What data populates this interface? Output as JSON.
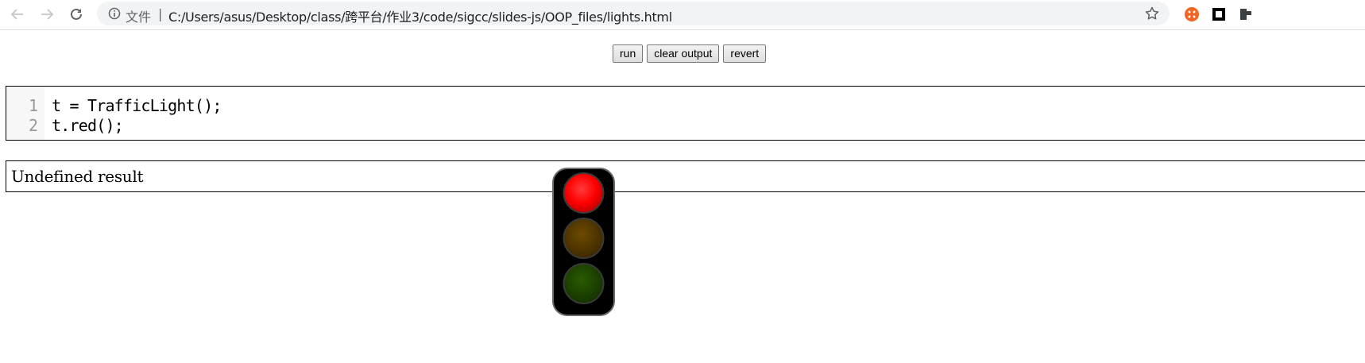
{
  "browser": {
    "scheme_label": "文件",
    "separator": "|",
    "url": "C:/Users/asus/Desktop/class/跨平台/作业3/code/sigcc/slides-js/OOP_files/lights.html",
    "nav_icons": [
      "back-arrow-icon",
      "forward-arrow-icon",
      "reload-icon"
    ],
    "omnibox_icons": [
      "info-icon",
      "star-icon"
    ],
    "extension_icons": [
      "orange-extension-icon",
      "square-extension-icon",
      "puzzle-extension-icon"
    ]
  },
  "toolbar": {
    "run_label": "run",
    "clear_label": "clear output",
    "revert_label": "revert"
  },
  "editor": {
    "lines": [
      {
        "number": "1",
        "code": "t = TrafficLight();"
      },
      {
        "number": "2",
        "code": "t.red();"
      }
    ]
  },
  "output": {
    "text": "Undefined result"
  },
  "traffic_light": {
    "active": "red",
    "colors": {
      "red_on": "#ff0000",
      "amber_off": "#5a3c00",
      "green_off": "#1f4a00",
      "housing": "#000000"
    }
  }
}
